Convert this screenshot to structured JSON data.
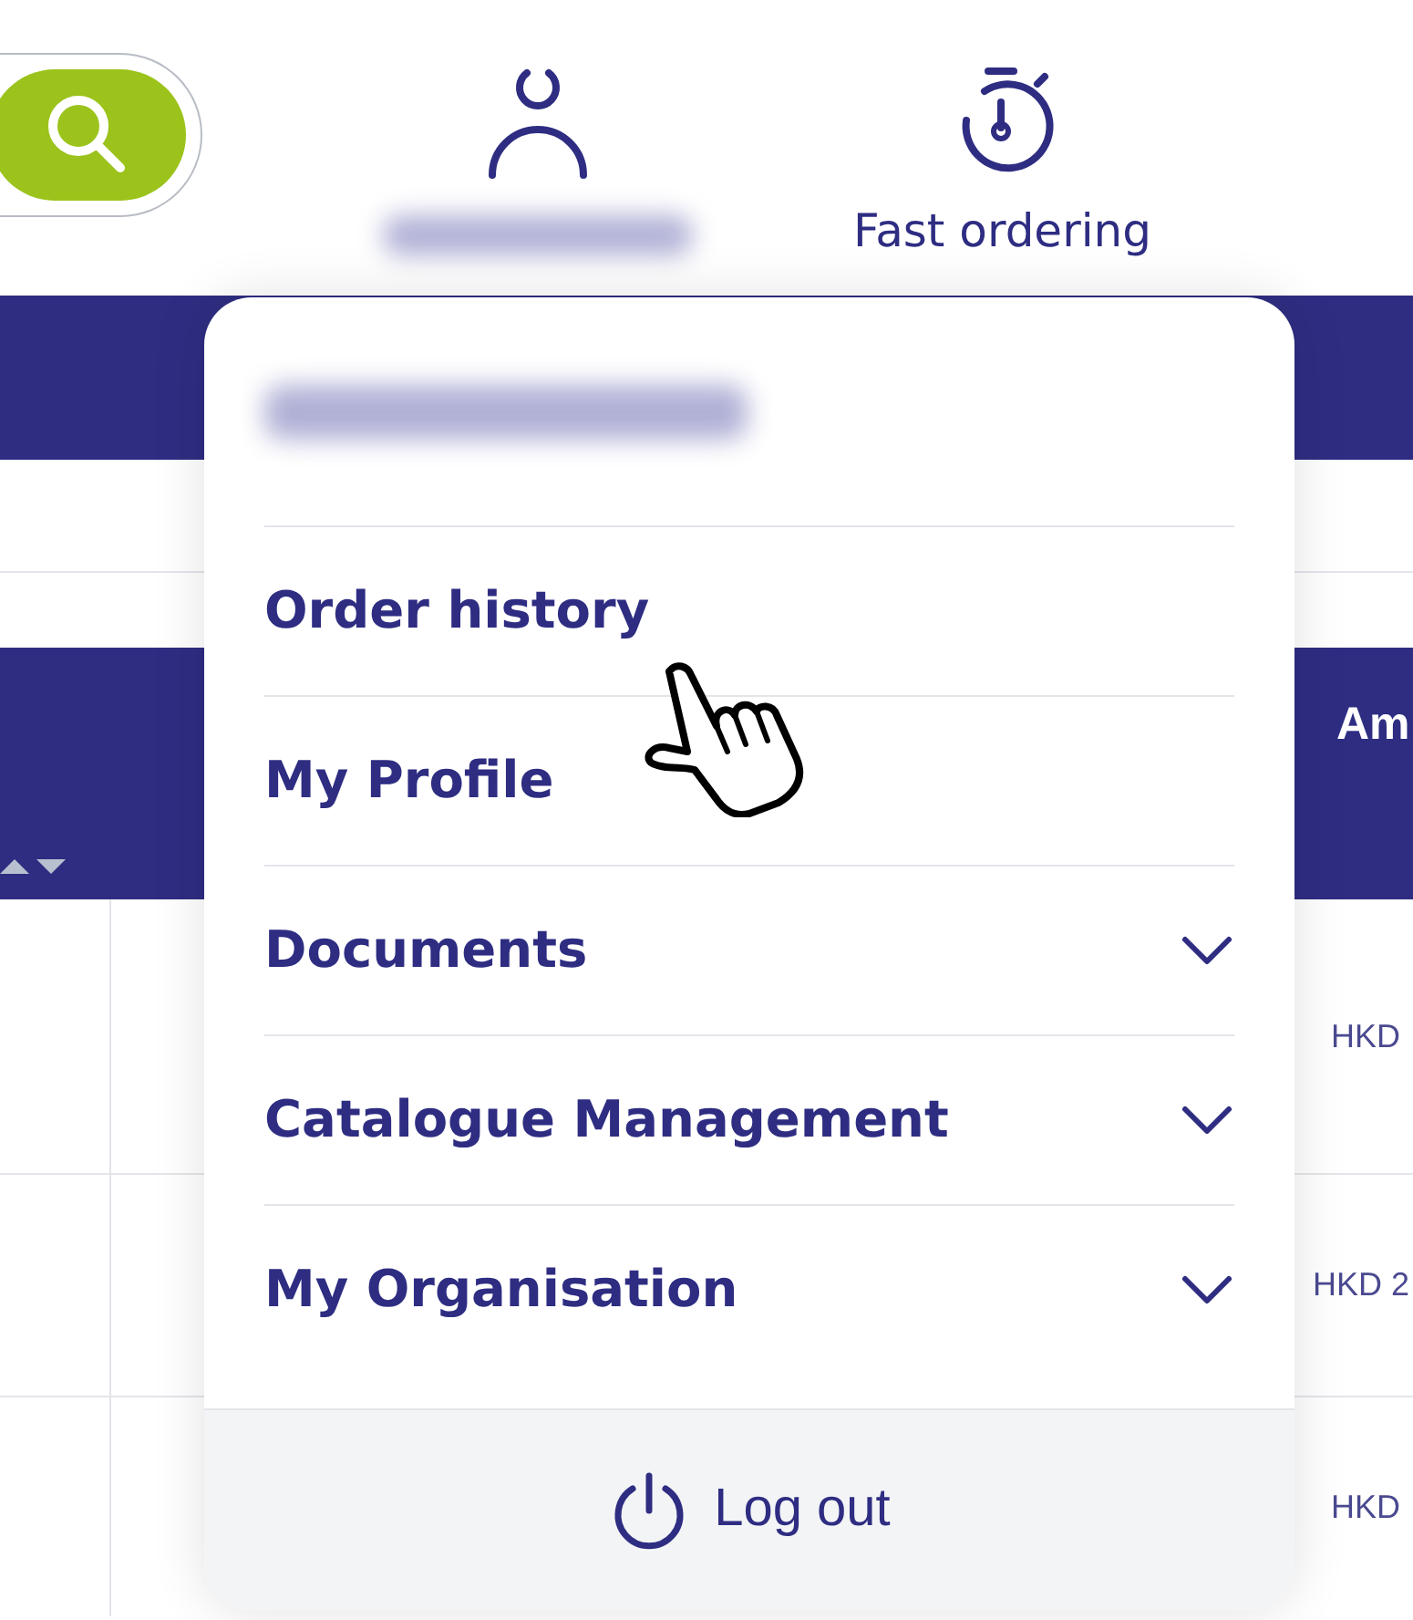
{
  "header": {
    "fast_ordering": "Fast ordering"
  },
  "table": {
    "column_header": "Am",
    "rows": [
      {
        "amount": "HKD"
      },
      {
        "amount": "HKD 2"
      },
      {
        "amount": "HKD"
      }
    ]
  },
  "menu": {
    "items": [
      {
        "label": "Order history",
        "expandable": false
      },
      {
        "label": "My Profile",
        "expandable": false
      },
      {
        "label": "Documents",
        "expandable": true
      },
      {
        "label": "Catalogue Management",
        "expandable": true
      },
      {
        "label": "My Organisation",
        "expandable": true
      }
    ],
    "logout": "Log out"
  }
}
